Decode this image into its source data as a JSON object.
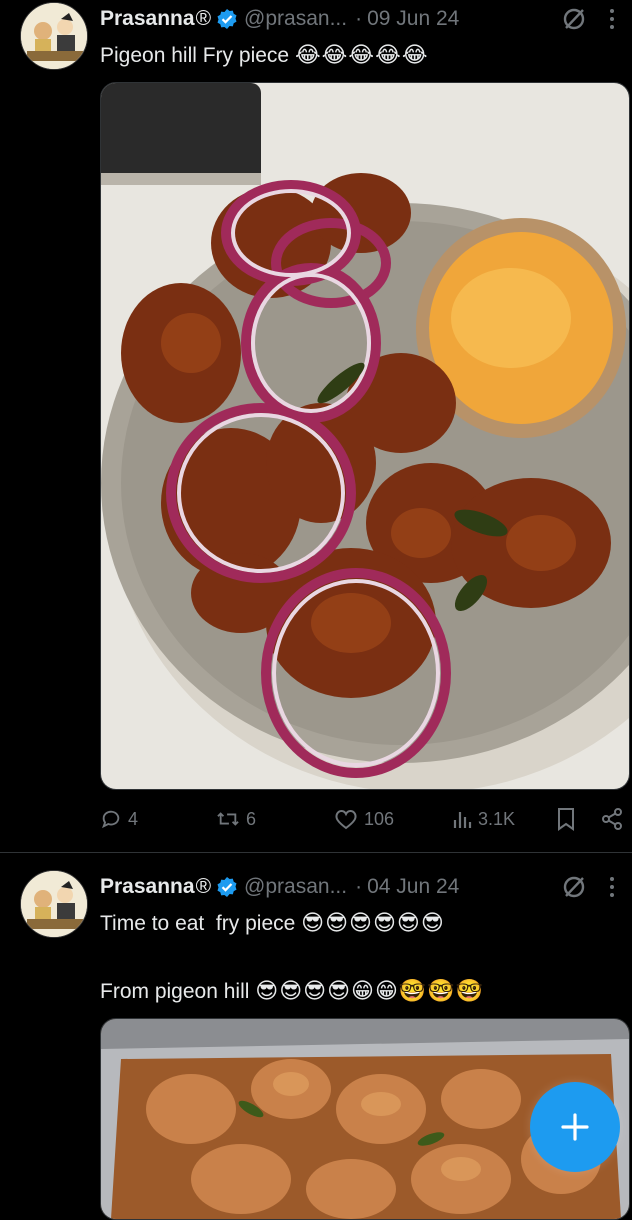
{
  "tweets": [
    {
      "author_name": "Prasanna",
      "author_mark": "®",
      "handle": "@prasan...",
      "separator": "·",
      "date": "09 Jun 24",
      "text": "Pigeon hill Fry piece",
      "emojis": [
        "😂",
        "😂",
        "😂",
        "😂",
        "😂"
      ],
      "media_icon": "food-plate-photo",
      "actions": {
        "replies": "4",
        "reposts": "6",
        "likes": "106",
        "views": "3.1K"
      }
    },
    {
      "author_name": "Prasanna",
      "author_mark": "®",
      "handle": "@prasan...",
      "separator": "·",
      "date": "04 Jun 24",
      "text_line1": "Time to eat  fry piece",
      "emojis_line1": [
        "😎",
        "😎",
        "😎",
        "😎",
        "😎",
        "😎"
      ],
      "text_line2": "From pigeon hill",
      "emojis_line2": [
        "😎",
        "😎",
        "😎",
        "😎",
        "😁",
        "😁",
        "🤓",
        "🤓",
        "🤓"
      ],
      "media_icon": "food-tray-photo"
    }
  ],
  "colors": {
    "background": "#000000",
    "text": "#e7e9ea",
    "secondary": "#71767b",
    "accent": "#1d9bf0",
    "divider": "#2f3336"
  },
  "fab": {
    "icon": "plus-icon"
  }
}
